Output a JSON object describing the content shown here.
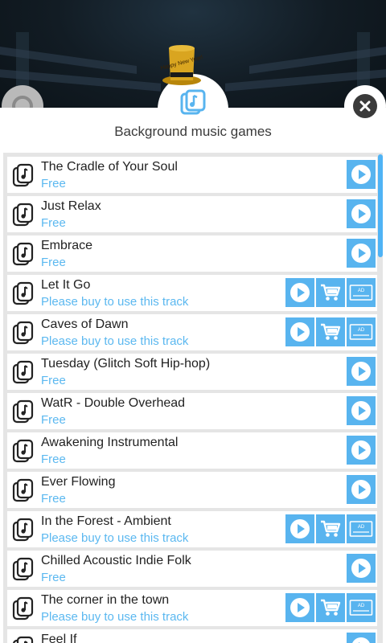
{
  "header": {
    "title": "Background music games",
    "hat_text": "Happy New Year!",
    "tab_icon": "music-folder-icon",
    "close_icon": "close-icon"
  },
  "colors": {
    "accent": "#58b4ef",
    "status_text": "#5bb8f0",
    "scrollbar": "#4fb3f5"
  },
  "tracks": [
    {
      "name": "The Cradle of Your Soul",
      "status": "Free",
      "type": "free"
    },
    {
      "name": "Just Relax",
      "status": "Free",
      "type": "free"
    },
    {
      "name": "Embrace",
      "status": "Free",
      "type": "free"
    },
    {
      "name": "Let It Go",
      "status": "Please buy to use this track",
      "type": "paid"
    },
    {
      "name": "Caves of Dawn",
      "status": "Please buy to use this track",
      "type": "paid"
    },
    {
      "name": "Tuesday (Glitch Soft Hip-hop)",
      "status": "Free",
      "type": "free"
    },
    {
      "name": "WatR - Double Overhead",
      "status": "Free",
      "type": "free"
    },
    {
      "name": "Awakening Instrumental",
      "status": "Free",
      "type": "free"
    },
    {
      "name": "Ever Flowing",
      "status": "Free",
      "type": "free"
    },
    {
      "name": "In the Forest - Ambient",
      "status": "Please buy to use this track",
      "type": "paid"
    },
    {
      "name": "Chilled Acoustic Indie Folk",
      "status": "Free",
      "type": "free"
    },
    {
      "name": "The corner in the town",
      "status": "Please buy to use this track",
      "type": "paid"
    },
    {
      "name": "Feel If",
      "status": "",
      "type": "free"
    }
  ],
  "buttons": {
    "play_icon": "play-icon",
    "cart_icon": "cart-icon",
    "ad_icon": "ad-video-icon",
    "ad_label": "AD"
  }
}
